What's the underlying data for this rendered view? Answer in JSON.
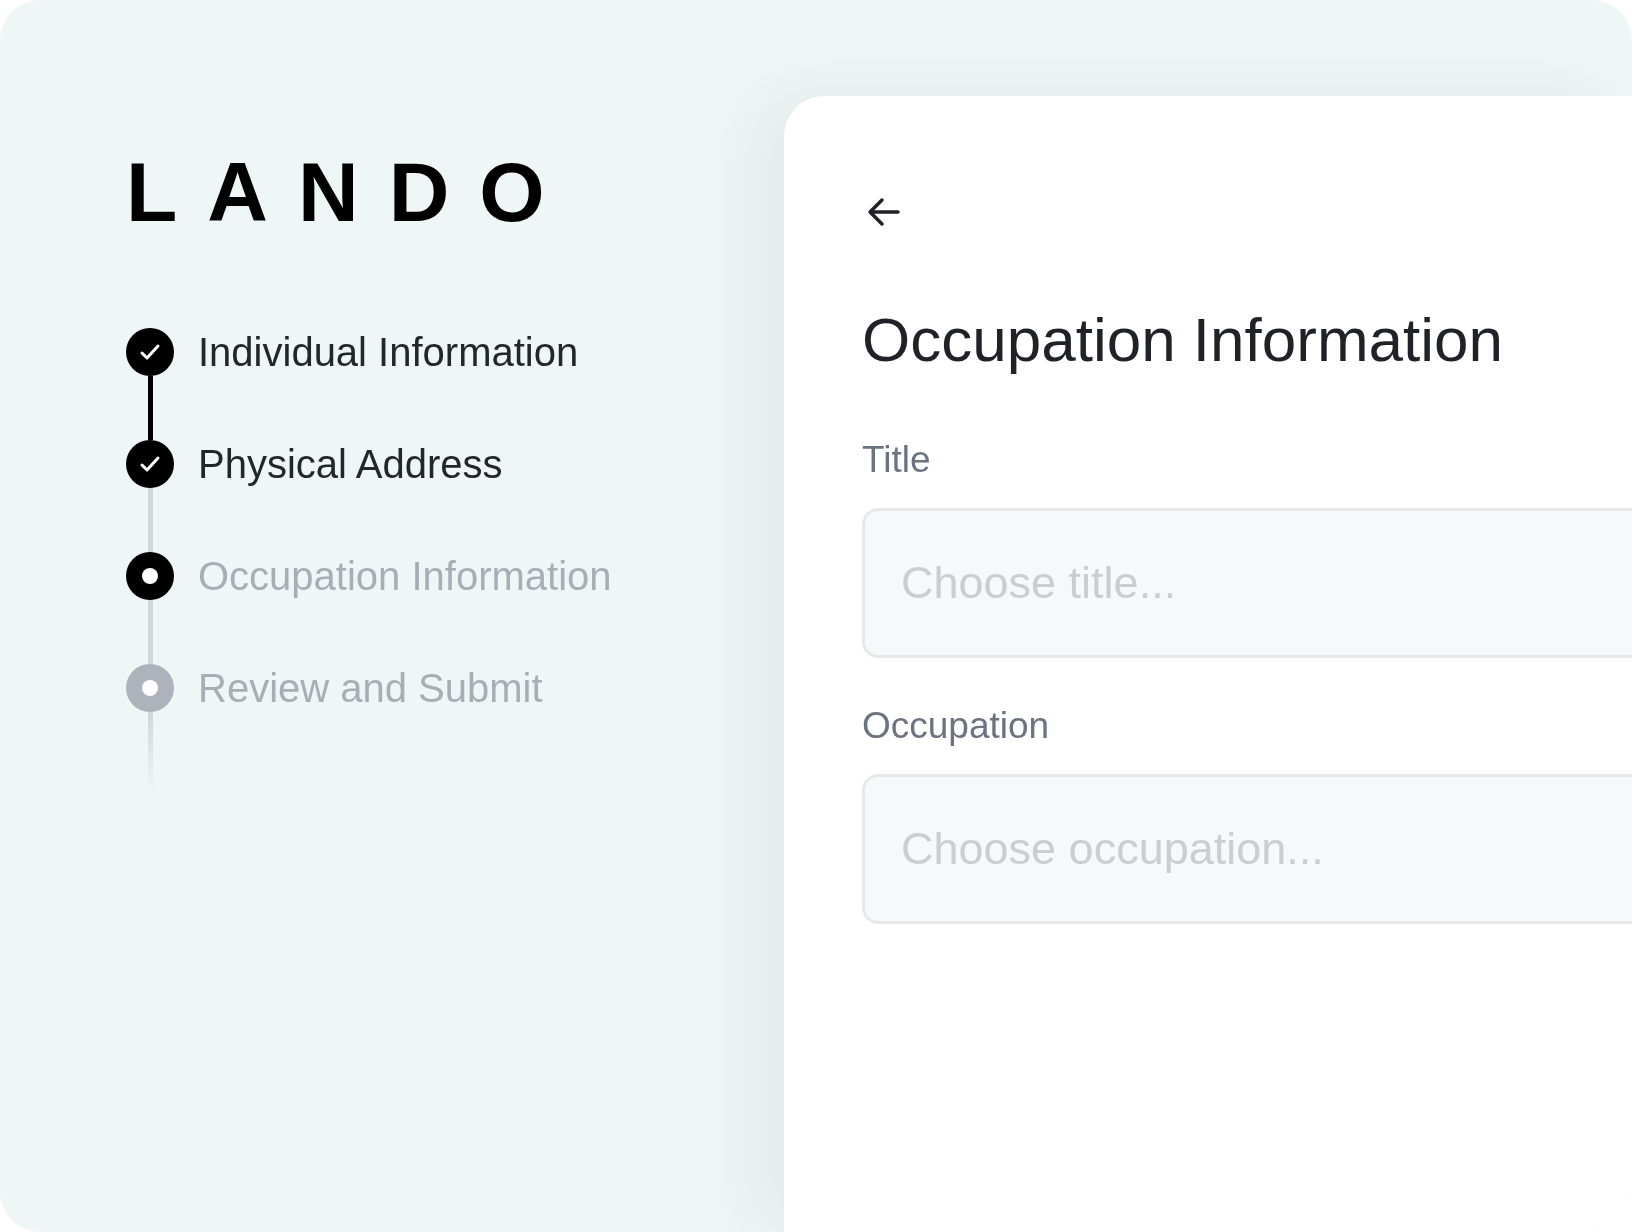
{
  "logo": "LANDO",
  "steps": [
    {
      "label": "Individual Information",
      "kind": "done"
    },
    {
      "label": "Physical Address",
      "kind": "done"
    },
    {
      "label": "Occupation Information",
      "kind": "current"
    },
    {
      "label": "Review and Submit",
      "kind": "upcoming"
    }
  ],
  "form": {
    "title": "Occupation Information",
    "fields": [
      {
        "label": "Title",
        "placeholder": "Choose title..."
      },
      {
        "label": "Occupation",
        "placeholder": "Choose occupation..."
      }
    ]
  }
}
